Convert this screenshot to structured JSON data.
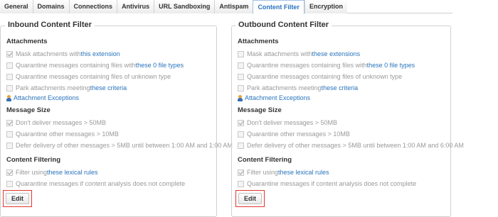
{
  "tabs": [
    {
      "label": "General"
    },
    {
      "label": "Domains"
    },
    {
      "label": "Connections"
    },
    {
      "label": "Antivirus"
    },
    {
      "label": "URL Sandboxing"
    },
    {
      "label": "Antispam"
    },
    {
      "label": "Content Filter",
      "active": true
    },
    {
      "label": "Encryption"
    }
  ],
  "inbound": {
    "title": "Inbound Content Filter",
    "attachments_heading": "Attachments",
    "mask": {
      "checked": true,
      "text": "Mask attachments with ",
      "link": "this extension"
    },
    "quarantine_types": {
      "checked": false,
      "text": "Quarantine messages containing files with ",
      "link": "these 0 file types"
    },
    "quarantine_unknown": {
      "checked": false,
      "text": "Quarantine messages containing files of unknown type"
    },
    "park": {
      "checked": false,
      "text": "Park attachments meeting ",
      "link": "these criteria"
    },
    "exceptions_link": "Attachment Exceptions",
    "exceptions_icon": "user-icon",
    "size_heading": "Message Size",
    "dont_deliver": {
      "checked": true,
      "text": "Don't deliver messages > 50MB"
    },
    "quarantine_other": {
      "checked": false,
      "text": "Quarantine other messages > 10MB"
    },
    "defer": {
      "checked": false,
      "text": "Defer delivery of other messages > 5MB until between 1:00 AM and 1:00 AM"
    },
    "filtering_heading": "Content Filtering",
    "filter": {
      "checked": true,
      "text": "Filter using ",
      "link": "these lexical rules"
    },
    "quarantine_analysis": {
      "checked": false,
      "text": "Quarantine messages if content analysis does not complete"
    },
    "edit_label": "Edit"
  },
  "outbound": {
    "title": "Outbound Content Filter",
    "attachments_heading": "Attachments",
    "mask": {
      "checked": false,
      "text": "Mask attachments with ",
      "link": "these extensions"
    },
    "quarantine_types": {
      "checked": false,
      "text": "Quarantine messages containing files with ",
      "link": "these 0 file types"
    },
    "quarantine_unknown": {
      "checked": false,
      "text": "Quarantine messages containing files of unknown type"
    },
    "park": {
      "checked": false,
      "text": "Park attachments meeting ",
      "link": "these criteria"
    },
    "exceptions_link": "Attachment Exceptions",
    "exceptions_icon": "user-icon",
    "size_heading": "Message Size",
    "dont_deliver": {
      "checked": true,
      "text": "Don't deliver messages > 50MB"
    },
    "quarantine_other": {
      "checked": false,
      "text": "Quarantine other messages > 10MB"
    },
    "defer": {
      "checked": false,
      "text": "Defer delivery of other messages > 5MB until between 1:00 AM and 6:00 AM"
    },
    "filtering_heading": "Content Filtering",
    "filter": {
      "checked": true,
      "text": "Filter using ",
      "link": "these lexical rules"
    },
    "quarantine_analysis": {
      "checked": false,
      "text": "Quarantine messages if content analysis does not complete"
    },
    "edit_label": "Edit"
  },
  "colors": {
    "link": "#2a74bd",
    "active_tab_border": "#9fc3e6",
    "highlight": "#e3362e"
  }
}
